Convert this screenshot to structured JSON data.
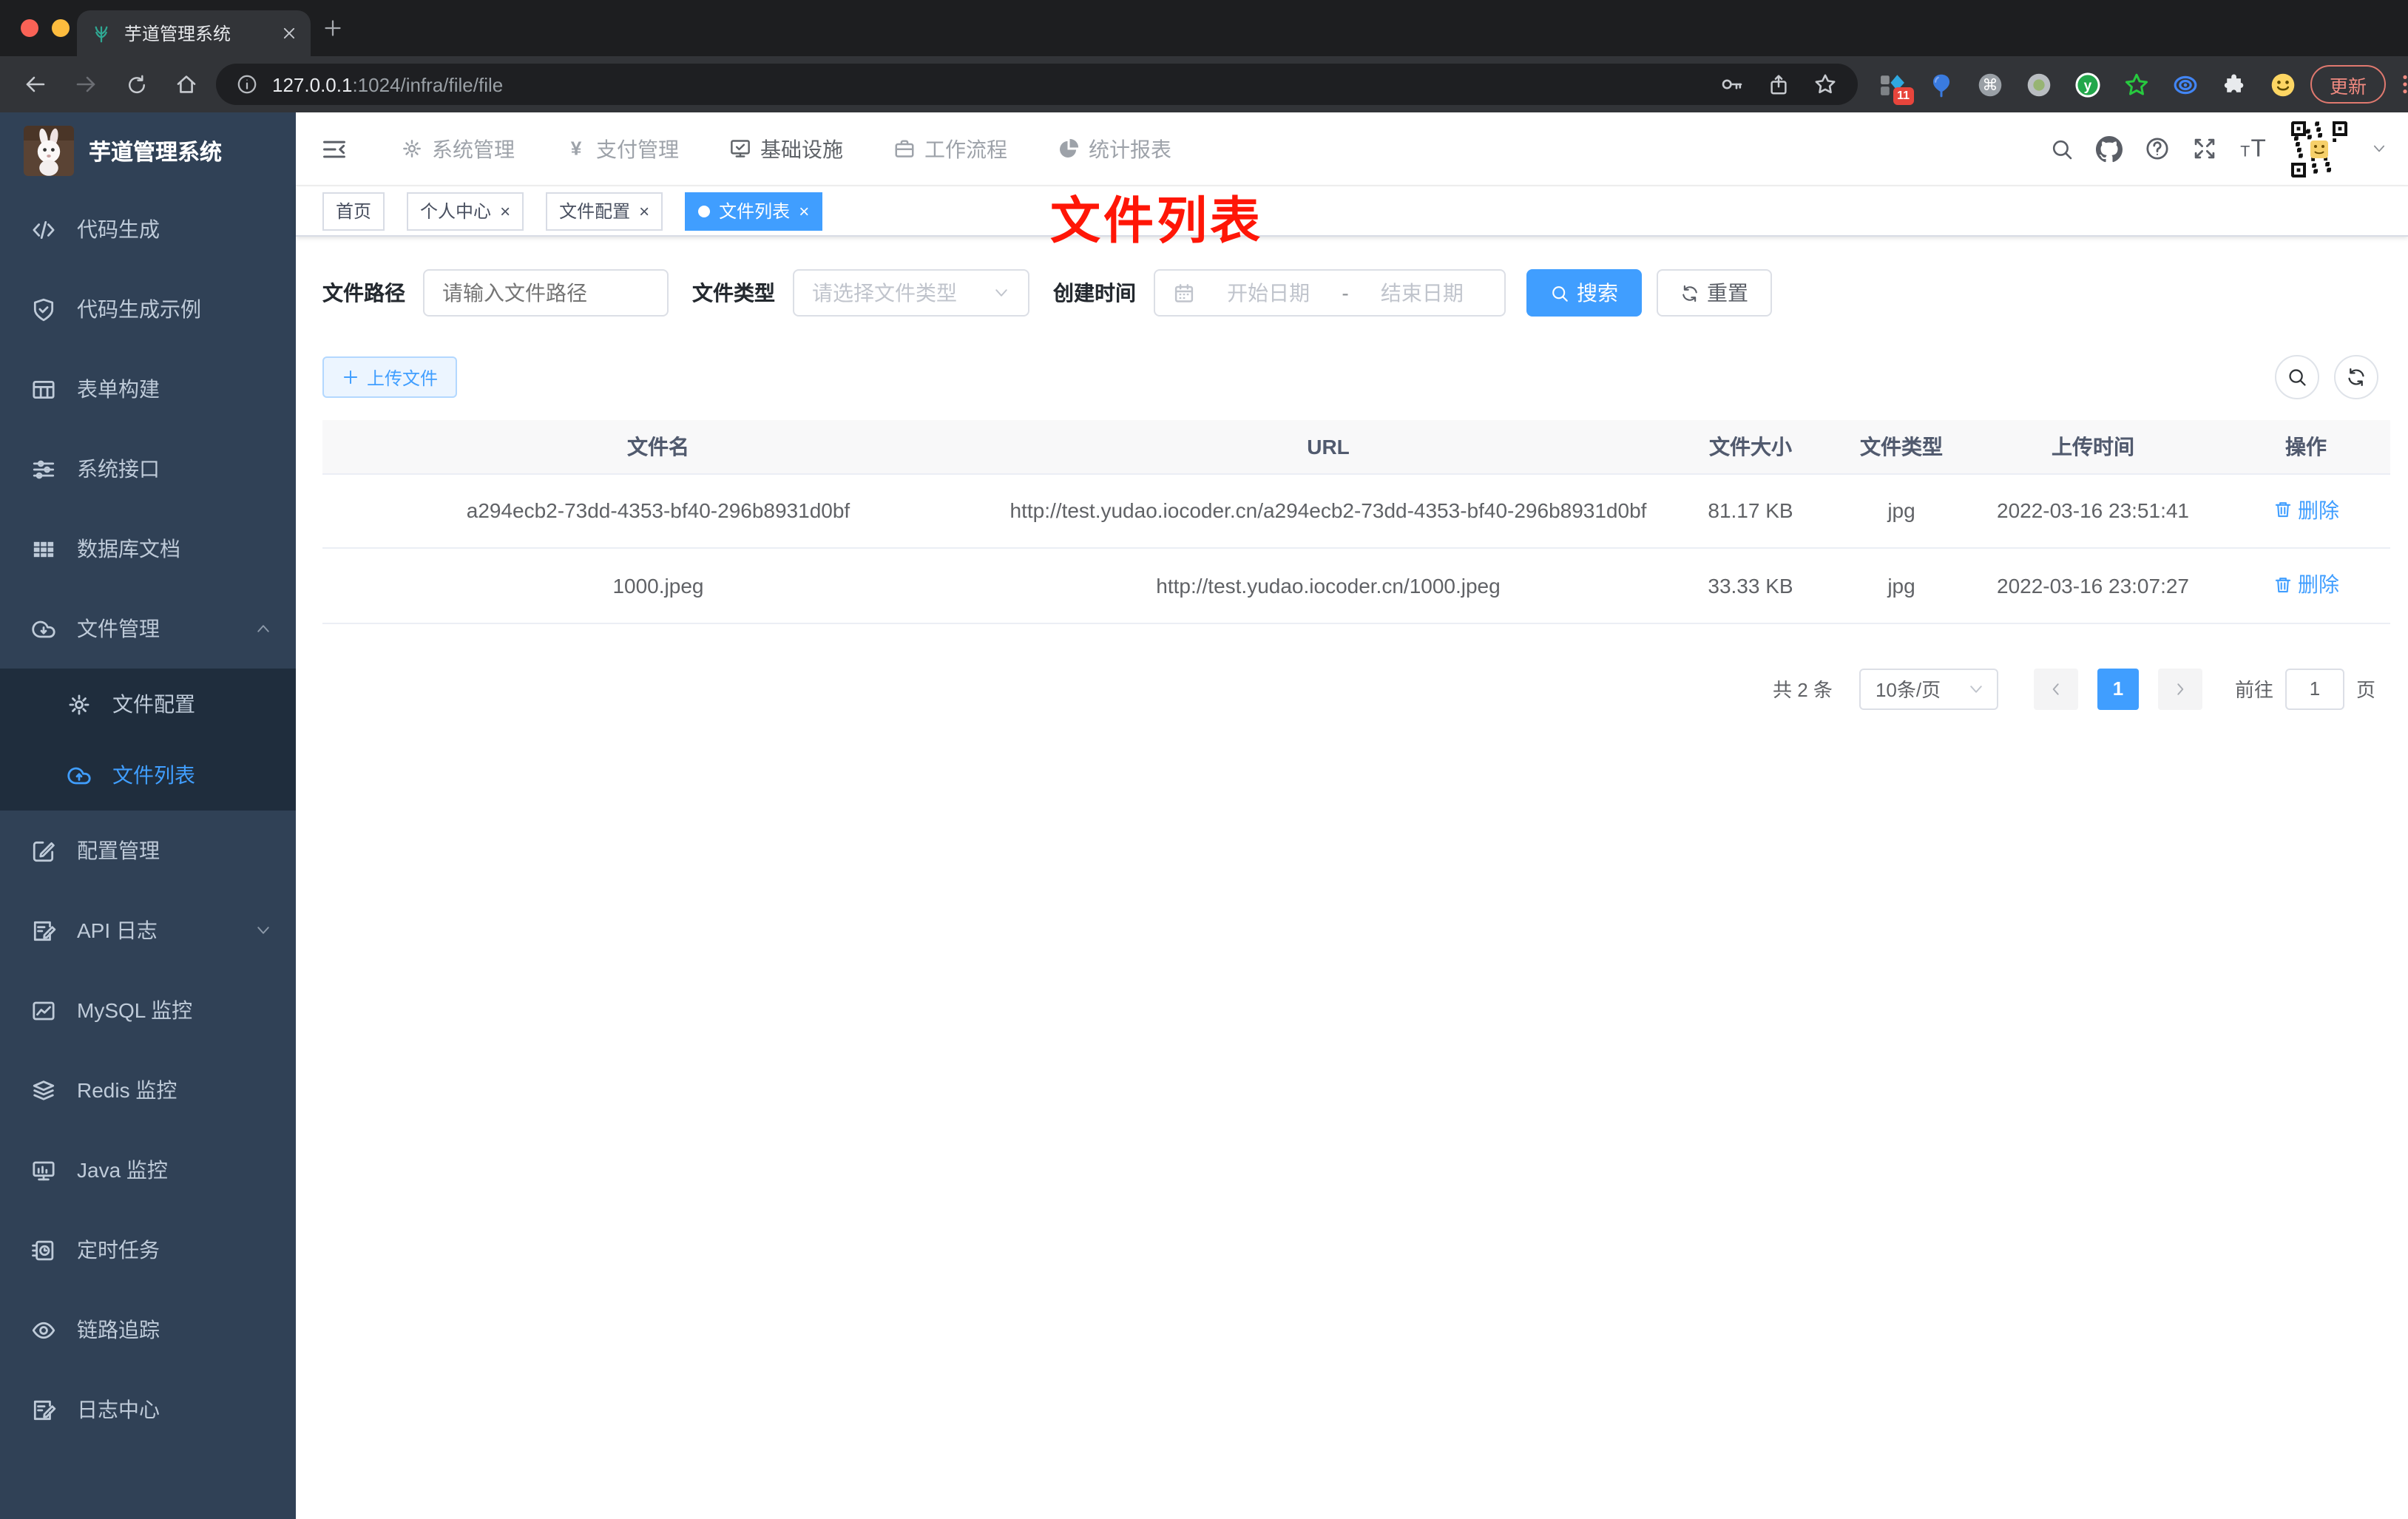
{
  "browser": {
    "tab_title": "芋道管理系统",
    "url": {
      "host": "127.0.0.1",
      "path": ":1024/infra/file/file"
    },
    "update_label": "更新",
    "extensions_badge": "11",
    "extension_icons": [
      "pixel-blocks-extension-icon",
      "balloon-extension-icon",
      "command-extension-icon",
      "dot-circle-extension-icon",
      "y-badge-extension-icon",
      "green-star-extension-icon",
      "rings-extension-icon",
      "puzzle-extension-icon",
      "emoji-extension-icon"
    ]
  },
  "sidebar": {
    "title": "芋道管理系统",
    "items": [
      {
        "label": "代码生成",
        "icon": "code-icon"
      },
      {
        "label": "代码生成示例",
        "icon": "shield-check-icon"
      },
      {
        "label": "表单构建",
        "icon": "form-table-icon"
      },
      {
        "label": "系统接口",
        "icon": "sliders-icon"
      },
      {
        "label": "数据库文档",
        "icon": "database-grid-icon"
      },
      {
        "label": "文件管理",
        "icon": "cloud-download-icon",
        "expanded": true,
        "children": [
          {
            "label": "文件配置",
            "icon": "gear-icon"
          },
          {
            "label": "文件列表",
            "icon": "cloud-upload-icon",
            "active": true
          }
        ]
      },
      {
        "label": "配置管理",
        "icon": "edit-square-icon"
      },
      {
        "label": "API 日志",
        "icon": "document-edit-icon",
        "collapsed": true
      },
      {
        "label": "MySQL 监控",
        "icon": "line-chart-icon"
      },
      {
        "label": "Redis 监控",
        "icon": "layers-icon"
      },
      {
        "label": "Java 监控",
        "icon": "monitor-bars-icon"
      },
      {
        "label": "定时任务",
        "icon": "schedule-icon"
      },
      {
        "label": "链路追踪",
        "icon": "eye-icon"
      },
      {
        "label": "日志中心",
        "icon": "log-edit-icon"
      }
    ]
  },
  "header": {
    "menus": [
      {
        "label": "系统管理",
        "icon": "gear-icon",
        "active": false
      },
      {
        "label": "支付管理",
        "icon": "yen-icon",
        "active": false
      },
      {
        "label": "基础设施",
        "icon": "monitor-check-icon",
        "active": true
      },
      {
        "label": "工作流程",
        "icon": "briefcase-icon",
        "active": false
      },
      {
        "label": "统计报表",
        "icon": "pie-chart-icon",
        "active": false
      }
    ]
  },
  "tags": [
    {
      "label": "首页",
      "closable": false,
      "active": false
    },
    {
      "label": "个人中心",
      "closable": true,
      "active": false
    },
    {
      "label": "文件配置",
      "closable": true,
      "active": false
    },
    {
      "label": "文件列表",
      "closable": true,
      "active": true
    }
  ],
  "annotation": {
    "text": "文件列表"
  },
  "filters": {
    "path_label": "文件路径",
    "path_placeholder": "请输入文件路径",
    "type_label": "文件类型",
    "type_placeholder": "请选择文件类型",
    "date_label": "创建时间",
    "date_start_placeholder": "开始日期",
    "date_separator": "-",
    "date_end_placeholder": "结束日期",
    "search_label": "搜索",
    "reset_label": "重置"
  },
  "actions": {
    "upload_label": "上传文件"
  },
  "table": {
    "headers": [
      "文件名",
      "URL",
      "文件大小",
      "文件类型",
      "上传时间",
      "操作"
    ],
    "rows": [
      {
        "name": "a294ecb2-73dd-4353-bf40-296b8931d0bf",
        "url": "http://test.yudao.iocoder.cn/a294ecb2-73dd-4353-bf40-296b8931d0bf",
        "size": "81.17 KB",
        "type": "jpg",
        "time": "2022-03-16 23:51:41",
        "action": "删除"
      },
      {
        "name": "1000.jpeg",
        "url": "http://test.yudao.iocoder.cn/1000.jpeg",
        "size": "33.33 KB",
        "type": "jpg",
        "time": "2022-03-16 23:07:27",
        "action": "删除"
      }
    ]
  },
  "pagination": {
    "total": "共 2 条",
    "page_size": "10条/页",
    "current_page": "1",
    "goto_label": "前往",
    "goto_value": "1",
    "unit_label": "页"
  },
  "colors": {
    "accent": "#409eff",
    "sidebar_bg": "#304156",
    "submenu_bg": "#1f2d3d",
    "annotation_red": "#ff1607",
    "tag_active": "#409eff",
    "upload_btn_bg": "#ecf5ff"
  }
}
